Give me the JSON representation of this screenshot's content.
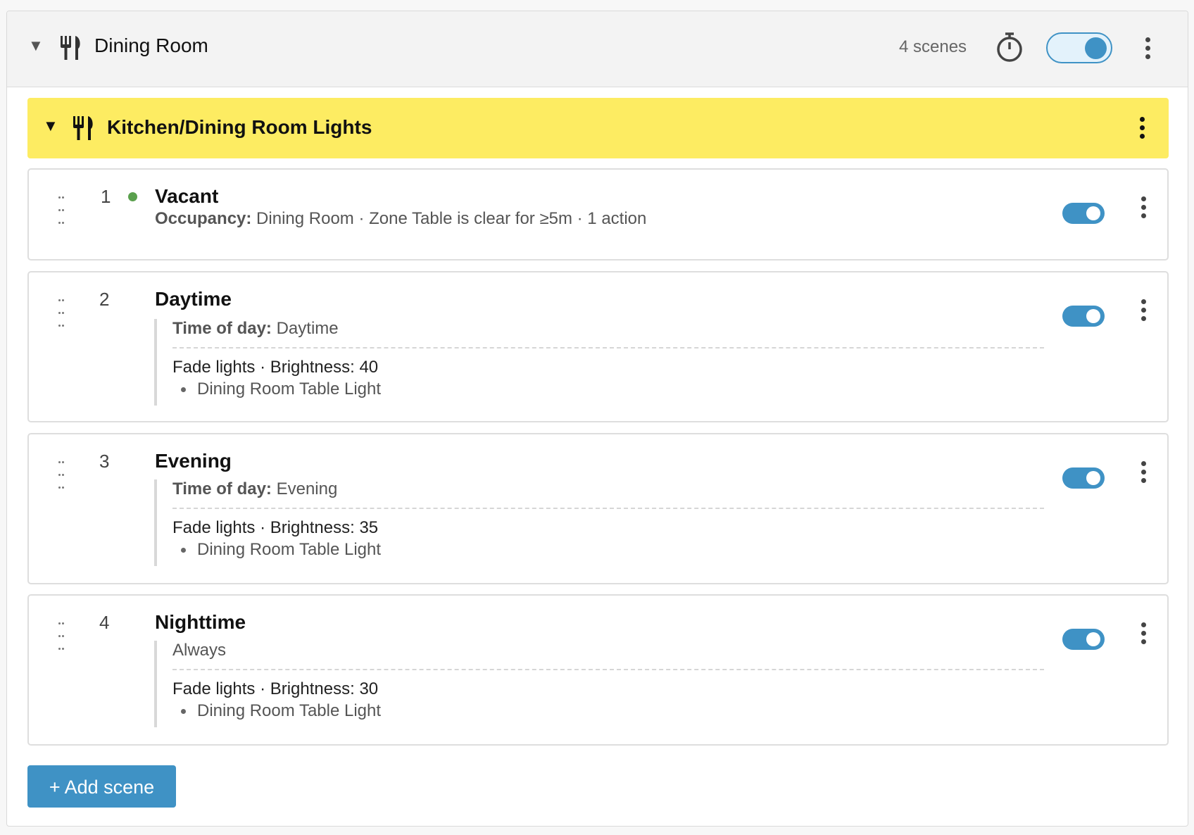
{
  "room": {
    "name": "Dining Room",
    "scene_count": "4 scenes",
    "enabled": true
  },
  "group": {
    "name": "Kitchen/Dining Room Lights",
    "color": "#fdec62"
  },
  "scenes": [
    {
      "index": "1",
      "name": "Vacant",
      "active": true,
      "cond_label": "Occupancy:",
      "cond_value": " Dining Room · Zone Table is clear for ≥5m · 1 action",
      "enabled": true
    },
    {
      "index": "2",
      "name": "Daytime",
      "cond_label": "Time of day:",
      "cond_value": " Daytime",
      "action": "Fade lights · Brightness: 40",
      "target": "Dining Room Table Light",
      "enabled": true
    },
    {
      "index": "3",
      "name": "Evening",
      "cond_label": "Time of day:",
      "cond_value": " Evening",
      "action": "Fade lights · Brightness: 35",
      "target": "Dining Room Table Light",
      "enabled": true
    },
    {
      "index": "4",
      "name": "Nighttime",
      "cond_plain": "Always",
      "action": "Fade lights · Brightness: 30",
      "target": "Dining Room Table Light",
      "enabled": true
    }
  ],
  "add_scene_label": "+ Add scene",
  "colors": {
    "accent": "#3f92c5",
    "active_dot": "#5aa04d"
  },
  "icons": {
    "room": "fork-knife-icon",
    "timer": "stopwatch-icon",
    "menu": "kebab-menu-icon",
    "drag": "drag-handle-icon"
  }
}
